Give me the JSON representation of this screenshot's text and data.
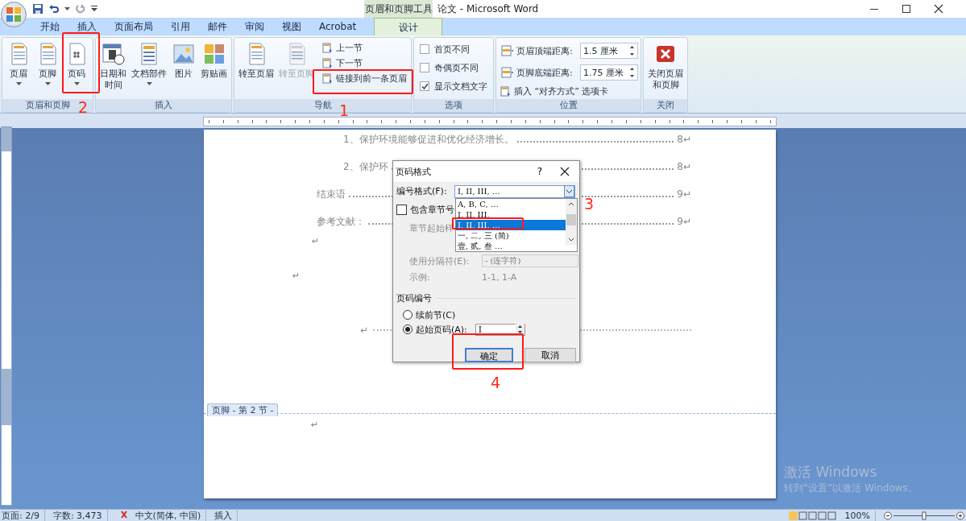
{
  "window": {
    "title": "论文 - Microsoft Word",
    "context_tab": "页眉和页脚工具"
  },
  "tabs": [
    {
      "label": "开始",
      "selected": false
    },
    {
      "label": "插入",
      "selected": false
    },
    {
      "label": "页面布局",
      "selected": false
    },
    {
      "label": "引用",
      "selected": false
    },
    {
      "label": "邮件",
      "selected": false
    },
    {
      "label": "审阅",
      "selected": false
    },
    {
      "label": "视图",
      "selected": false
    },
    {
      "label": "Acrobat",
      "selected": false
    },
    {
      "label": "设计",
      "selected": true
    }
  ],
  "ribbon_groups": [
    {
      "title": "页眉和页脚",
      "items": [
        {
          "kind": "large",
          "label": [
            "页眉"
          ],
          "dropdown": true,
          "disabled": false
        },
        {
          "kind": "large",
          "label": [
            "页脚"
          ],
          "dropdown": true,
          "disabled": false
        },
        {
          "kind": "large",
          "label": [
            "页码"
          ],
          "dropdown": true,
          "disabled": false
        }
      ]
    },
    {
      "title": "插入",
      "items": [
        {
          "kind": "large",
          "label": [
            "日期和",
            "时间"
          ],
          "dropdown": false,
          "disabled": false
        },
        {
          "kind": "large",
          "label": [
            "文档部件"
          ],
          "dropdown": true,
          "disabled": false
        },
        {
          "kind": "large",
          "label": [
            "图片"
          ],
          "dropdown": false,
          "disabled": false
        },
        {
          "kind": "large",
          "label": [
            "剪贴画"
          ],
          "dropdown": false,
          "disabled": false
        }
      ]
    },
    {
      "title": "导航",
      "items": [
        {
          "kind": "large",
          "label": [
            "转至页眉"
          ],
          "dropdown": false,
          "disabled": false
        },
        {
          "kind": "large",
          "label": [
            "转至页脚"
          ],
          "dropdown": false,
          "disabled": true
        },
        {
          "kind": "small",
          "label": "上一节"
        },
        {
          "kind": "small",
          "label": "下一节"
        },
        {
          "kind": "small",
          "label": "链接到前一条页眉"
        }
      ]
    },
    {
      "title": "选项",
      "items": [
        {
          "kind": "check",
          "label": "首页不同",
          "checked": false
        },
        {
          "kind": "check",
          "label": "奇偶页不同",
          "checked": false
        },
        {
          "kind": "check",
          "label": "显示文档文字",
          "checked": true
        }
      ]
    },
    {
      "title": "位置",
      "items": [
        {
          "kind": "spin",
          "label": "页眉顶端距离:",
          "value": "1.5 厘米"
        },
        {
          "kind": "spin",
          "label": "页脚底端距离:",
          "value": "1.75 厘米"
        },
        {
          "kind": "small",
          "label": "插入 “对齐方式” 选项卡"
        }
      ]
    },
    {
      "title": "关闭",
      "items": [
        {
          "kind": "large",
          "label": [
            "关闭页眉",
            "和页脚"
          ],
          "dropdown": false,
          "disabled": false
        }
      ]
    }
  ],
  "document": {
    "toc": [
      {
        "kind": "sub",
        "text": "1、保护环境能够促进和优化经济增长。",
        "page": "8↵"
      },
      {
        "kind": "sub",
        "text": "2、保护环",
        "page": "8↵"
      },
      {
        "kind": "main",
        "text": "结束语",
        "page": "9↵"
      },
      {
        "kind": "main",
        "text": "参考文献：",
        "page": "9↵"
      }
    ],
    "marks": [
      "↵",
      "↵",
      "↵"
    ],
    "footer_tab": "页脚 - 第 2 节 -",
    "footer_mark": "↵"
  },
  "dialog": {
    "title": "页码格式",
    "help": "?",
    "format_label": "编号格式(F):",
    "format_value": "I, II, III, …",
    "format_options": [
      {
        "text": "A, B, C, …",
        "selected": false
      },
      {
        "text": "I, II, III,",
        "selected": false
      },
      {
        "text": "I, II, III, …",
        "selected": true
      },
      {
        "text": "一, 二, 三 (简)",
        "selected": false
      },
      {
        "text": "壹, 贰, 叁 …",
        "selected": false
      }
    ],
    "include_chapter": {
      "label": "包含章节号",
      "checked": false
    },
    "chapter_style_label": "章节起始样",
    "separator_label": "使用分隔符(E):",
    "separator_value": "-  (连字符)",
    "example_label": "示例:",
    "example_value": "1-1, 1-A",
    "numbering_title": "页码编号",
    "radios": [
      {
        "label": "续前节(C)",
        "selected": false
      },
      {
        "label": "起始页码(A):",
        "selected": true
      }
    ],
    "start_value": "I",
    "buttons": [
      {
        "label": "确定",
        "default": true
      },
      {
        "label": "取消",
        "default": false
      }
    ]
  },
  "annotations": [
    {
      "label": "1"
    },
    {
      "label": "2"
    },
    {
      "label": "3"
    },
    {
      "label": "4"
    }
  ],
  "activation": {
    "title": "激活 Windows",
    "text": "转到“设置”以激活 Windows。"
  },
  "status_bar": {
    "page": "页面: 2/9",
    "words": "字数: 3,473",
    "language": "中文(简体, 中国)",
    "mode": "插入",
    "zoom": "100%",
    "zoom_slider": {
      "level": 0.5
    }
  }
}
